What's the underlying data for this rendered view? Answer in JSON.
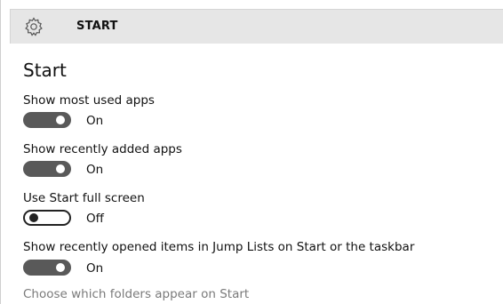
{
  "header": {
    "title": "START",
    "icon": "gear-icon"
  },
  "page": {
    "title": "Start"
  },
  "settings": [
    {
      "label": "Show most used apps",
      "state": "On",
      "on": true
    },
    {
      "label": "Show recently added apps",
      "state": "On",
      "on": true
    },
    {
      "label": "Use Start full screen",
      "state": "Off",
      "on": false
    },
    {
      "label": "Show recently opened items in Jump Lists on Start or the taskbar",
      "state": "On",
      "on": true
    }
  ],
  "link": {
    "label": "Choose which folders appear on Start"
  },
  "colors": {
    "header_bg": "#e6e6e6",
    "toggle_on": "#595959",
    "link": "#7a7a7a"
  }
}
